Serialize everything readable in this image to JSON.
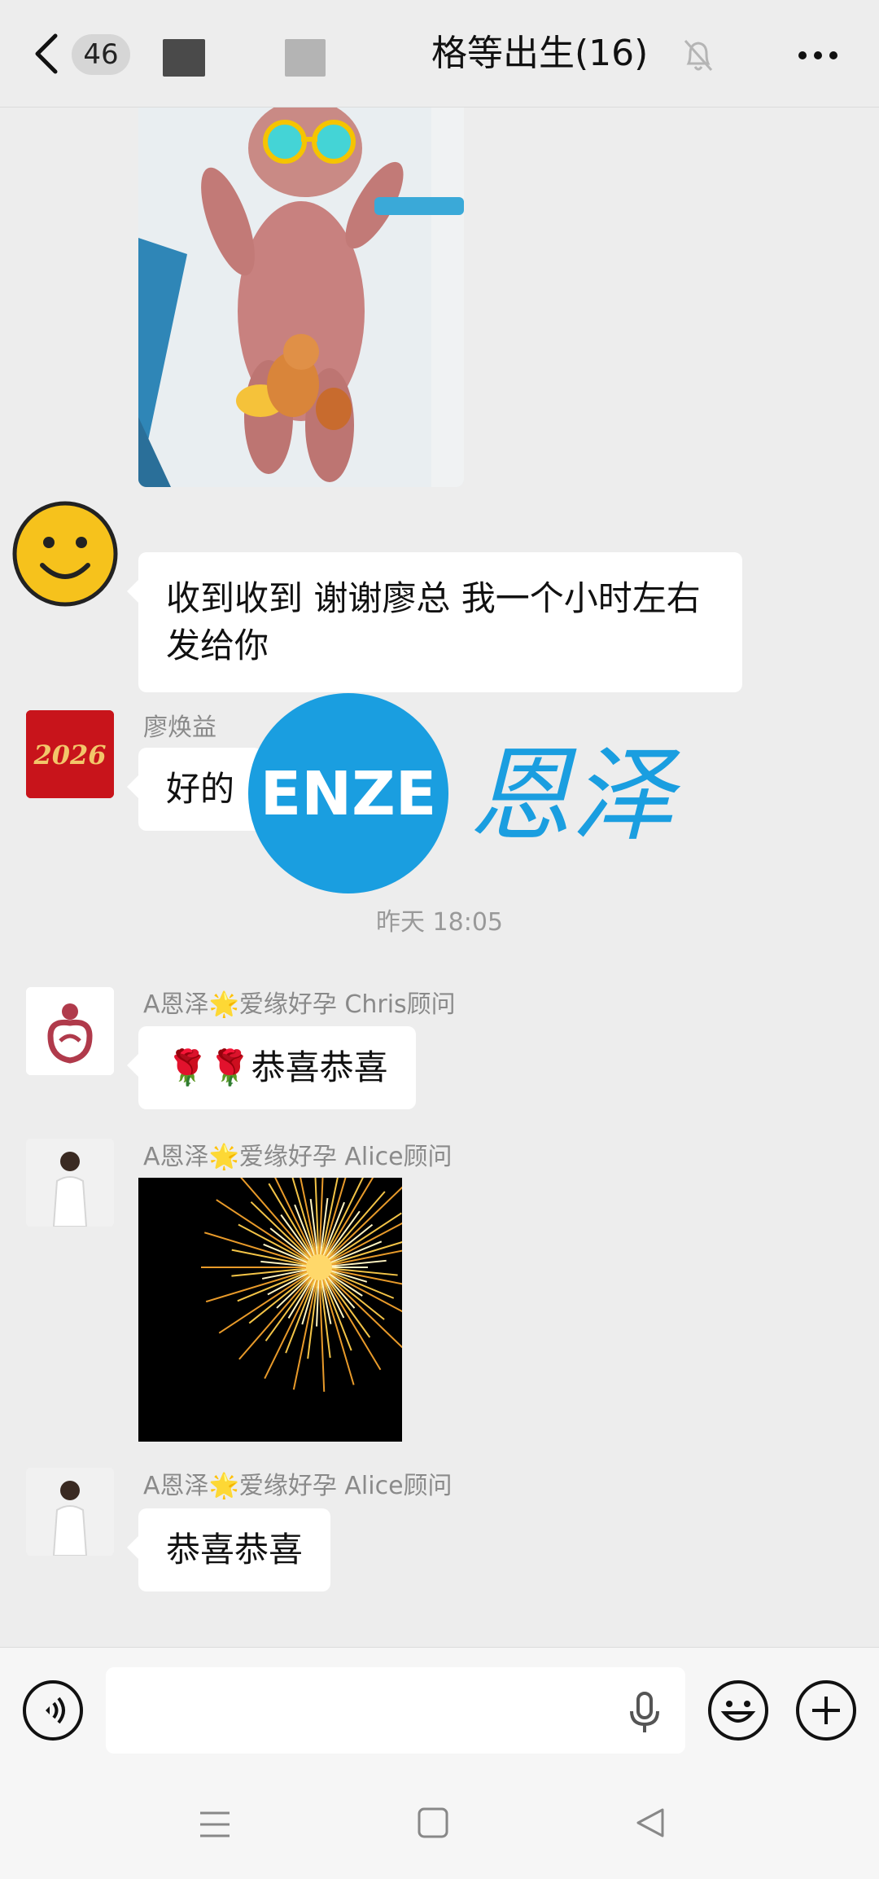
{
  "header": {
    "unread_count": "46",
    "title": "格等出生(16)"
  },
  "messages": [
    {
      "type": "image",
      "content": "newborn-baby-photo"
    },
    {
      "type": "text",
      "sender": "",
      "text": "收到收到 谢谢廖总 我一个小时左右发给你"
    },
    {
      "type": "text",
      "sender": "廖焕益",
      "text": "好的"
    },
    {
      "type": "timestamp",
      "text": "昨天 18:05"
    },
    {
      "type": "text",
      "sender": "A恩泽🌟爱缘好孕 Chris顾问",
      "text": "🌹🌹恭喜恭喜"
    },
    {
      "type": "image",
      "sender": "A恩泽🌟爱缘好孕 Alice顾问",
      "content": "fireworks"
    },
    {
      "type": "text",
      "sender": "A恩泽🌟爱缘好孕 Alice顾问",
      "text": "恭喜恭喜"
    }
  ],
  "avatars": {
    "liao": "2026",
    "watermark_logo": "ENZE",
    "watermark_text": "恩泽"
  },
  "input": {
    "placeholder": ""
  },
  "colors": {
    "background": "#ededed",
    "bubble": "#ffffff",
    "watermark_blue": "#1a9ee0"
  }
}
